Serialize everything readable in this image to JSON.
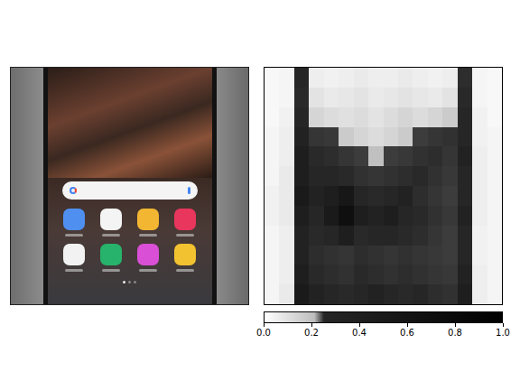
{
  "figure": {
    "heatmap": {
      "values": [
        [
          0.02,
          0.03,
          0.5,
          0.05,
          0.04,
          0.05,
          0.06,
          0.05,
          0.05,
          0.06,
          0.05,
          0.04,
          0.05,
          0.4,
          0.03,
          0.02
        ],
        [
          0.02,
          0.03,
          0.45,
          0.08,
          0.06,
          0.07,
          0.08,
          0.06,
          0.07,
          0.08,
          0.07,
          0.06,
          0.08,
          0.45,
          0.03,
          0.02
        ],
        [
          0.02,
          0.04,
          0.5,
          0.12,
          0.1,
          0.09,
          0.1,
          0.08,
          0.1,
          0.12,
          0.1,
          0.12,
          0.15,
          0.5,
          0.04,
          0.02
        ],
        [
          0.03,
          0.05,
          0.55,
          0.3,
          0.25,
          0.15,
          0.12,
          0.1,
          0.12,
          0.15,
          0.2,
          0.3,
          0.35,
          0.5,
          0.04,
          0.03
        ],
        [
          0.03,
          0.05,
          0.6,
          0.45,
          0.4,
          0.3,
          0.2,
          0.18,
          0.2,
          0.25,
          0.35,
          0.4,
          0.3,
          0.55,
          0.05,
          0.03
        ],
        [
          0.03,
          0.06,
          0.6,
          0.5,
          0.5,
          0.45,
          0.35,
          0.3,
          0.35,
          0.4,
          0.45,
          0.35,
          0.25,
          0.5,
          0.05,
          0.03
        ],
        [
          0.04,
          0.06,
          0.65,
          0.55,
          0.6,
          0.7,
          0.5,
          0.45,
          0.5,
          0.55,
          0.4,
          0.3,
          0.2,
          0.5,
          0.05,
          0.03
        ],
        [
          0.04,
          0.06,
          0.6,
          0.5,
          0.65,
          0.8,
          0.6,
          0.55,
          0.6,
          0.5,
          0.45,
          0.35,
          0.25,
          0.55,
          0.05,
          0.03
        ],
        [
          0.03,
          0.05,
          0.55,
          0.45,
          0.5,
          0.6,
          0.45,
          0.5,
          0.5,
          0.45,
          0.4,
          0.3,
          0.2,
          0.5,
          0.04,
          0.03
        ],
        [
          0.03,
          0.05,
          0.55,
          0.4,
          0.35,
          0.3,
          0.4,
          0.35,
          0.3,
          0.35,
          0.3,
          0.25,
          0.2,
          0.5,
          0.04,
          0.03
        ],
        [
          0.03,
          0.05,
          0.6,
          0.45,
          0.4,
          0.35,
          0.45,
          0.4,
          0.35,
          0.4,
          0.35,
          0.3,
          0.25,
          0.55,
          0.05,
          0.03
        ],
        [
          0.03,
          0.06,
          0.65,
          0.55,
          0.5,
          0.45,
          0.5,
          0.55,
          0.5,
          0.45,
          0.5,
          0.4,
          0.35,
          0.6,
          0.05,
          0.03
        ]
      ]
    },
    "colorbar": {
      "ticks": [
        "0.0",
        "0.2",
        "0.4",
        "0.6",
        "0.8",
        "1.0"
      ]
    }
  }
}
